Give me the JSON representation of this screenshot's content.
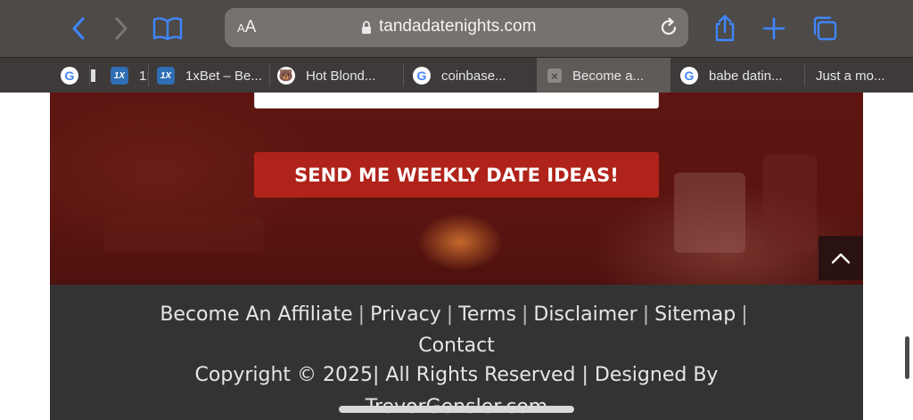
{
  "browser": {
    "address_prefix_small": "A",
    "address_prefix_big": "A",
    "url": "tandadatenights.com",
    "icons": {
      "back": "chevron-left-icon",
      "forward": "chevron-right-icon",
      "reader": "book-icon",
      "reload": "reload-icon",
      "share": "share-icon",
      "new_tab": "plus-icon",
      "tabs": "tabs-overview-icon",
      "lock": "lock-icon"
    },
    "accent_color": "#3f86ff"
  },
  "tabs": [
    {
      "favicon": "G",
      "label": ""
    },
    {
      "favicon": "",
      "label": ""
    },
    {
      "favicon": "1X",
      "label": "1:"
    },
    {
      "favicon": "1X",
      "label": "1xBet – Be..."
    },
    {
      "favicon": "🐻",
      "label": "Hot Blond..."
    },
    {
      "favicon": "G",
      "label": "coinbase..."
    },
    {
      "favicon": "×",
      "label": "Become a...",
      "active": true
    },
    {
      "favicon": "G",
      "label": "babe datin..."
    },
    {
      "favicon": "",
      "label": "Just a mo..."
    }
  ],
  "hero": {
    "email_placeholder": "",
    "cta_label": "SEND ME WEEKLY DATE IDEAS!",
    "cta_color": "#b0231a"
  },
  "footer": {
    "links": [
      "Become An Affiliate",
      "Privacy",
      "Terms",
      "Disclaimer",
      "Sitemap",
      "Contact"
    ],
    "separator": "|",
    "copyright_line1": "Copyright © 2025| All Rights Reserved | Designed By",
    "copyright_line2": "TrevorGensler.com"
  }
}
